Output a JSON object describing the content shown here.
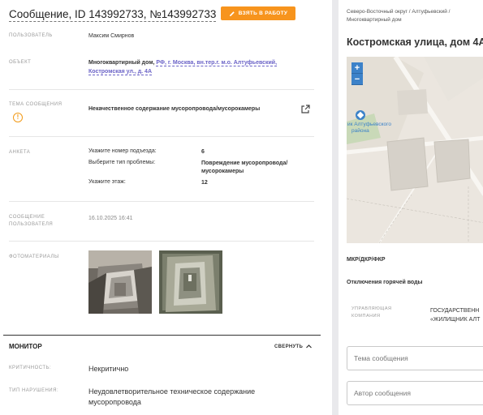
{
  "header": {
    "title": "Сообщение, ID 143992733, №143992733",
    "take_button": "ВЗЯТЬ В РАБОТУ"
  },
  "fields": {
    "user_label": "ПОЛЬЗОВАТЕЛЬ",
    "user_value": "Максим Смирнов",
    "object_label": "ОБЪЕКТ",
    "object_type": "Многоквартирный дом,",
    "object_link_1": "РФ, г. Москва, вн.тер.г. м.о. Алтуфьевский,",
    "object_link_2": "Костромская ул., д. 4А",
    "topic_label": "ТЕМА СООБЩЕНИЯ",
    "topic_value": "Некачественное содержание мусоропровода/мусорокамеры",
    "survey_label": "АНКЕТА",
    "survey": [
      {
        "q": "Укажите номер подъезда:",
        "a": "6"
      },
      {
        "q": "Выберите тип проблемы:",
        "a": "Повреждение мусоропровода/\nмусорокамеры"
      },
      {
        "q": "Укажите этаж:",
        "a": "12"
      }
    ],
    "message_label_1": "СООБЩЕНИЕ",
    "message_label_2": "ПОЛЬЗОВАТЕЛЯ",
    "message_date": "16.10.2025 16:41",
    "photos_label": "ФОТОМАТЕРИАЛЫ"
  },
  "monitor": {
    "title": "МОНИТОР",
    "collapse": "СВЕРНУТЬ",
    "criticality_label": "КРИТИЧНОСТЬ:",
    "criticality_value": "Некритично",
    "violation_label": "ТИП НАРУШЕНИЯ:",
    "violation_value_1": "Неудовлетворительное техническое содержание",
    "violation_value_2": "мусоропровода"
  },
  "right": {
    "breadcrumb_1": "Северо-Восточный округ / Алтуфьевский /",
    "breadcrumb_2": "Многоквартирный дом",
    "title": "Костромская улица, дом 4А",
    "map_label_1": "ик Алтуфьевского",
    "map_label_2": "района",
    "zoom_in": "+",
    "zoom_out": "−",
    "mkr": "МКР/ДКР/ФКР",
    "hot_water": "Отключения горячей воды",
    "uk_label_1": "УПРАВЛЯЮЩАЯ",
    "uk_label_2": "КОМПАНИЯ",
    "uk_value_1": "ГОСУДАРСТВЕНН",
    "uk_value_2": "«ЖИЛИЩНИК АЛТ",
    "topic_placeholder": "Тема сообщения",
    "author_placeholder": "Автор сообщения"
  },
  "colors": {
    "accent": "#f7941d",
    "link": "#6b63c7",
    "map_marker": "#3c82c9"
  }
}
